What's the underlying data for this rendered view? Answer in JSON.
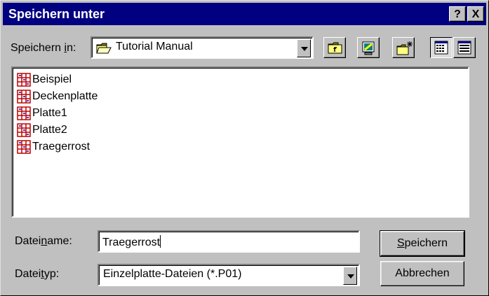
{
  "window": {
    "title": "Speichern unter",
    "help_btn": "?",
    "close_btn": "X"
  },
  "location": {
    "label_pre": "Speichern ",
    "label_accel": "i",
    "label_post": "n:",
    "value": "Tutorial Manual"
  },
  "toolbar": {
    "icons": [
      "folder-up-icon",
      "desktop-icon",
      "new-folder-icon",
      "list-view-icon",
      "details-view-icon"
    ]
  },
  "files": [
    {
      "name": "Beispiel"
    },
    {
      "name": "Deckenplatte"
    },
    {
      "name": "Platte1"
    },
    {
      "name": "Platte2"
    },
    {
      "name": "Traegerrost"
    }
  ],
  "filename": {
    "label_pre": "Datei",
    "label_accel": "n",
    "label_post": "ame:",
    "value": "Traegerrost"
  },
  "filetype": {
    "label_pre": "Datei",
    "label_accel": "t",
    "label_post": "yp:",
    "value": "Einzelplatte-Dateien (*.P01)"
  },
  "buttons": {
    "save_accel": "S",
    "save_rest": "peichern",
    "cancel": "Abbrechen"
  },
  "colors": {
    "titlebar": "#000080",
    "face": "#c0c0c0",
    "file_icon": "#c00000",
    "folder": "#ffff80"
  }
}
